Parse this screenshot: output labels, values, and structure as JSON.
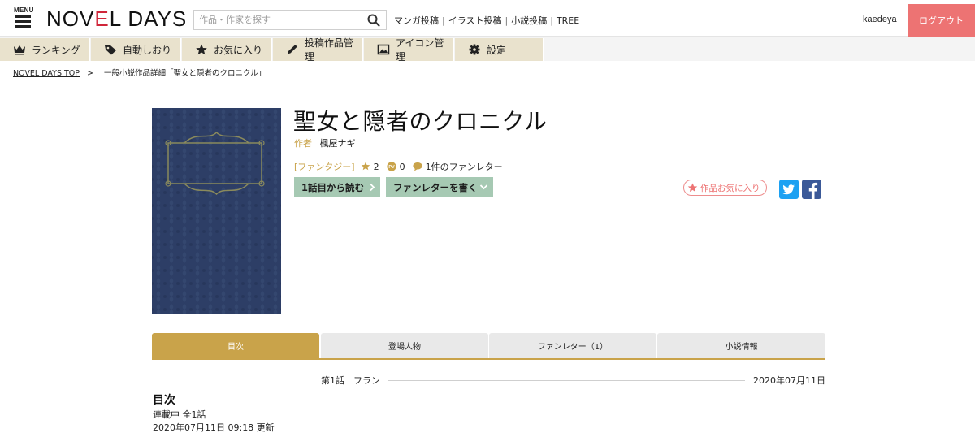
{
  "header": {
    "menu_label": "MENU",
    "logo_part1": "NOV",
    "logo_accent": "E",
    "logo_part2": "L DAYS",
    "search_placeholder": "作品・作家を探す",
    "links": [
      "マンガ投稿",
      "イラスト投稿",
      "小説投稿",
      "TREE"
    ],
    "link_separator": "|",
    "username": "kaedeya",
    "logout_label": "ログアウト",
    "accent_color": "#ed7373",
    "logo_accent_color": "#d0263a"
  },
  "nav": {
    "items": [
      {
        "label": "ランキング",
        "icon": "crown-icon"
      },
      {
        "label": "自動しおり",
        "icon": "tag-icon"
      },
      {
        "label": "お気に入り",
        "icon": "star-icon"
      },
      {
        "label": "投稿作品管理",
        "icon": "pen-icon"
      },
      {
        "label": "アイコン管理",
        "icon": "image-icon"
      },
      {
        "label": "設定",
        "icon": "gear-icon"
      }
    ],
    "background": "#e9e2cd"
  },
  "breadcrumb": {
    "home": "NOVEL DAYS TOP",
    "separator": ">",
    "current": "一般小説作品詳細「聖女と隠者のクロニクル」"
  },
  "work": {
    "title": "聖女と隠者のクロニクル",
    "author_label": "作者",
    "author_name": "楓屋ナギ",
    "genre": "[ファンタジー]",
    "stars": "2",
    "pv": "0",
    "fan_letters": "1件のファンレター",
    "read_first_button": "1話目から読む",
    "write_letter_button": "ファンレターを書く",
    "favorite_button": "作品お気に入り",
    "cover_color": "#2d3e66",
    "gold_color": "#c9a34a",
    "button_color": "#a6c9b3"
  },
  "tabs": [
    {
      "label": "目次",
      "active": true
    },
    {
      "label": "登場人物",
      "active": false
    },
    {
      "label": "ファンレター（1）",
      "active": false
    },
    {
      "label": "小説情報",
      "active": false
    }
  ],
  "episodes": [
    {
      "label": "第1話　フラン",
      "date": "2020年07月11日"
    }
  ],
  "toc": {
    "heading": "目次",
    "status": "連載中 全1話",
    "updated": "2020年07月11日 09:18 更新"
  }
}
